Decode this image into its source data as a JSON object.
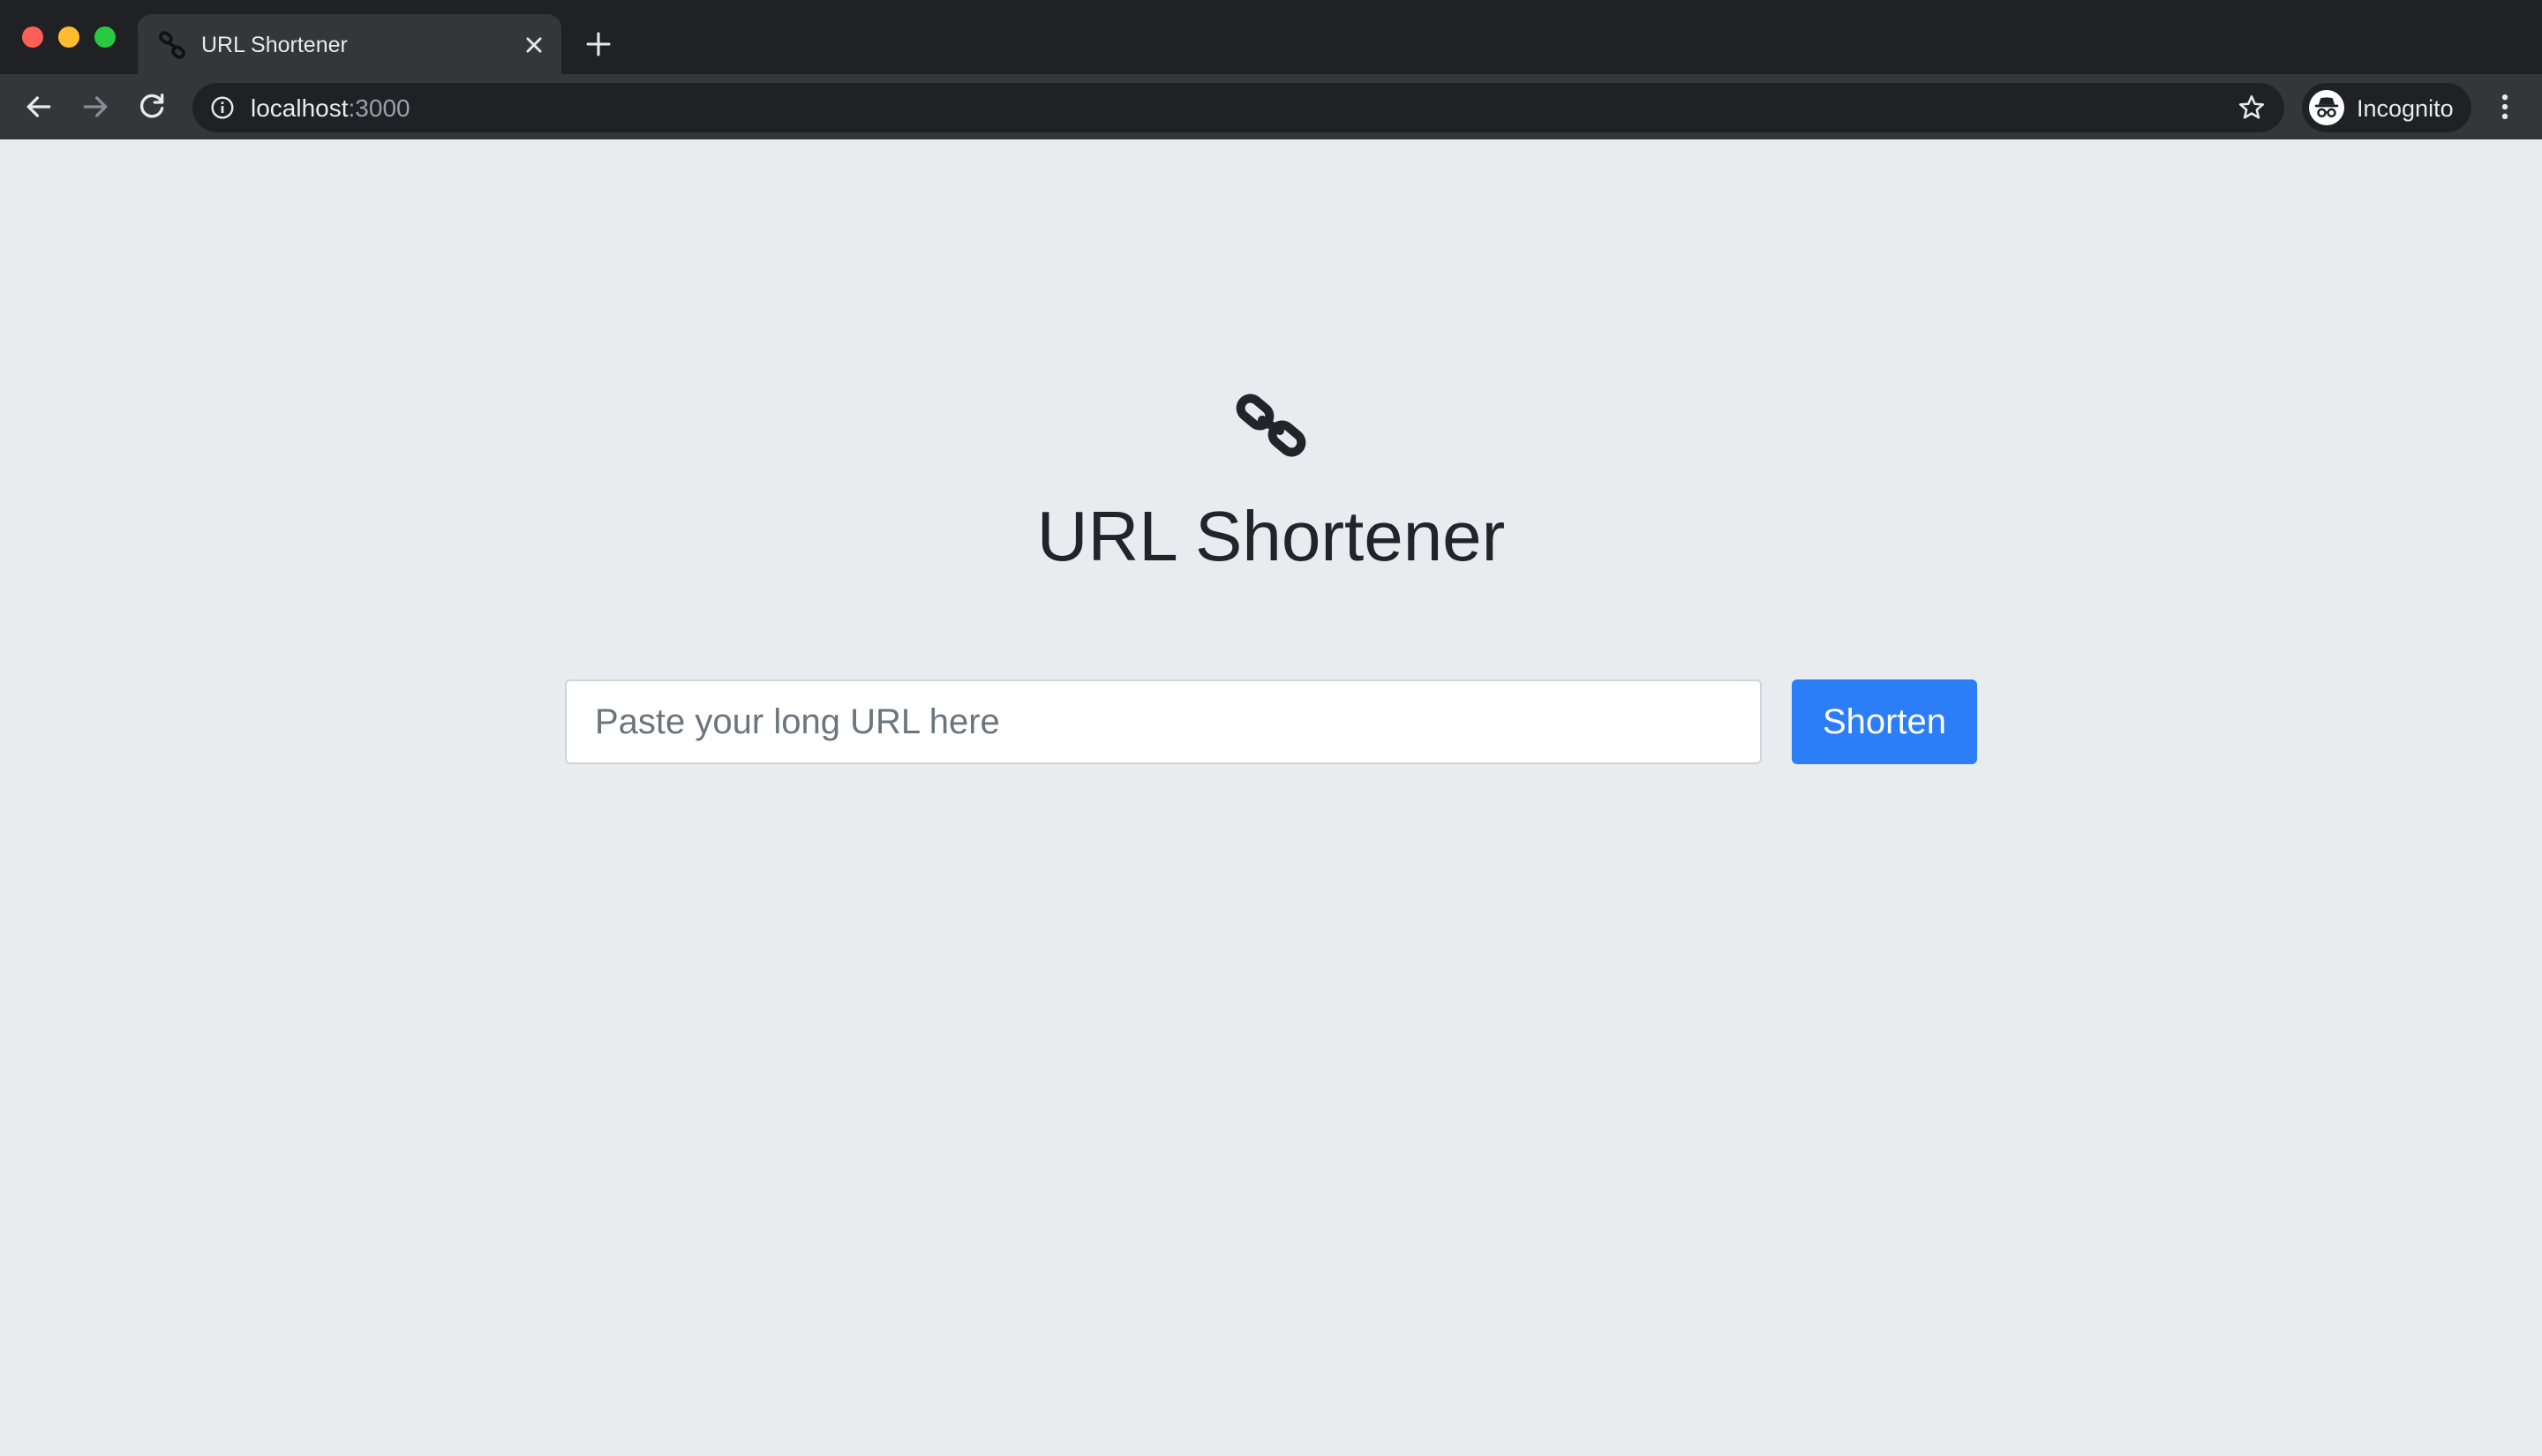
{
  "browser": {
    "tab": {
      "title": "URL Shortener",
      "favicon": "link-icon",
      "close_icon": "close-icon"
    },
    "new_tab_icon": "plus-icon",
    "nav": {
      "back_icon": "arrow-left-icon",
      "forward_icon": "arrow-right-icon",
      "reload_icon": "reload-icon"
    },
    "address_bar": {
      "icon": "info-icon",
      "host": "localhost",
      "port": ":3000",
      "bookmark_icon": "star-icon"
    },
    "profile": {
      "label": "Incognito",
      "icon": "incognito-icon"
    },
    "menu_icon": "kebab-menu-icon"
  },
  "page": {
    "logo_icon": "link-icon",
    "title": "URL Shortener",
    "url_input": {
      "placeholder": "Paste your long URL here",
      "value": ""
    },
    "shorten_button": {
      "label": "Shorten"
    },
    "colors": {
      "background": "#e9ecef",
      "primary": "#2c7ef8",
      "title": "#212529"
    }
  }
}
